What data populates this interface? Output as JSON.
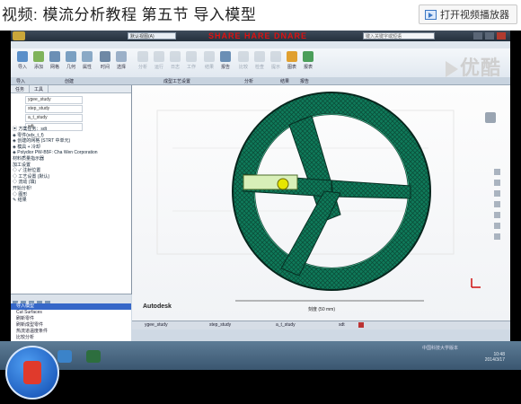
{
  "page": {
    "title": "视频: 模流分析教程 第五节 导入模型",
    "open_player_label": "打开视频播放器"
  },
  "video": {
    "watermark": "优酷"
  },
  "app": {
    "file_label": "默认视图(A)",
    "window_title": "SHARE HARE DNARE",
    "search_placeholder": "键入关键字或短语",
    "tabs": [
      "开始",
      "工具",
      "查看",
      "入门"
    ],
    "ribbon_items": [
      {
        "label": "导入",
        "color": "#5a8fc9",
        "disabled": false
      },
      {
        "label": "添加",
        "color": "#7fb35a",
        "disabled": false
      },
      {
        "label": "网格",
        "color": "#6b8fb5",
        "disabled": false
      },
      {
        "label": "几何",
        "color": "#7aa0c2",
        "disabled": false
      },
      {
        "label": "属性",
        "color": "#8aa9c6",
        "disabled": false
      },
      {
        "label": "时间",
        "color": "#6e88a5",
        "disabled": false
      },
      {
        "label": "选择",
        "color": "#9bb0c8",
        "disabled": false
      },
      {
        "label": "分析",
        "color": "#9ba9b8",
        "disabled": true
      },
      {
        "label": "运行",
        "color": "#9ba9b8",
        "disabled": true
      },
      {
        "label": "日志",
        "color": "#9ba9b8",
        "disabled": true
      },
      {
        "label": "工作",
        "color": "#9ba9b8",
        "disabled": true
      },
      {
        "label": "结果",
        "color": "#9ba9b8",
        "disabled": true
      },
      {
        "label": "报告",
        "color": "#6b8fb5",
        "disabled": false
      },
      {
        "label": "比较",
        "color": "#9ba9b8",
        "disabled": true
      },
      {
        "label": "检查",
        "color": "#9ba9b8",
        "disabled": true
      },
      {
        "label": "提示",
        "color": "#9ba9b8",
        "disabled": true
      },
      {
        "label": "图表",
        "color": "#e0a030",
        "disabled": false
      },
      {
        "label": "报表",
        "color": "#4b9e5a",
        "disabled": false
      }
    ],
    "ribbon_groups": [
      "导入",
      "创建",
      "成型工艺设置",
      "分析",
      "结果",
      "报告"
    ],
    "left_tabs": [
      "任务",
      "工具"
    ],
    "studies": [
      "ygee_study",
      "step_study",
      "a_t_study",
      "sdt"
    ],
    "tree": [
      "▣ 方案任务：sdt",
      " ◈ 零件(sdx_t_f)",
      "  ◈ 创建的网格 (STRT 中单元)",
      "  ◈ 模具 + 冷却",
      " ◈ Polydior PW-B5F: Cha Wen Corporation",
      "    材料质量指示器",
      "    加工设置",
      " ◇ ✓ 注射位置",
      " ◇ 工艺设置 (默认)",
      " ◇ 流动 (填)",
      "   开始分析!",
      " ◇ 图形",
      " ✎ 结果"
    ],
    "log_lines": [
      "导入模型",
      "Cut Surfaces",
      "刷新零件",
      "刷新成型零件",
      "热流道温度条件",
      "比较分析"
    ],
    "viewport": {
      "brand": "Autodesk",
      "scale_label": "刻度 (50 mm)"
    },
    "status_tabs": [
      "ygee_study",
      "step_study",
      "a_t_study",
      "sdt"
    ],
    "tray_time": "10:48",
    "tray_date": "2014/3/17",
    "status_right": "中国科技大学版本"
  }
}
